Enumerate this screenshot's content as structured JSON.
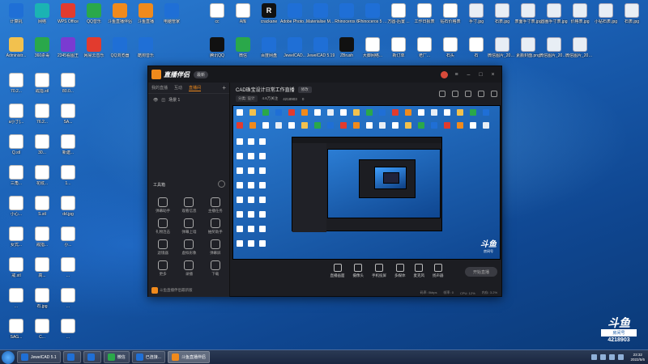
{
  "desktop": {
    "top_row": [
      {
        "label": "计算机",
        "color": "#1f6fd6"
      },
      {
        "label": "网络",
        "color": "#1bb3b3"
      },
      {
        "label": "WPS Office",
        "color": "#e23b2e"
      },
      {
        "label": "QQ音乐",
        "color": "#2aa84a"
      },
      {
        "label": "斗鱼直播伴侣",
        "color": "#f08a1c"
      },
      {
        "label": "斗鱼直播",
        "color": "#f08a1c"
      },
      {
        "label": "电脑管家",
        "color": "#1f6fd6"
      }
    ],
    "second_row": [
      {
        "label": "Administr...",
        "color": "#f2c14e"
      },
      {
        "label": "360杀毒",
        "color": "#2aa84a"
      },
      {
        "label": "2345看图王",
        "color": "#7a3bd1"
      },
      {
        "label": "网易云音乐",
        "color": "#e23b2e"
      },
      {
        "label": "QQ浏览器",
        "color": "#1f6fd6"
      },
      {
        "label": "酷狗音乐",
        "color": "#1f6fd6"
      }
    ],
    "top_files": [
      {
        "label": "cc",
        "type": "doc"
      },
      {
        "label": "A库",
        "type": "doc"
      },
      {
        "label": "crackane",
        "type": "black",
        "glyph": "R"
      },
      {
        "label": "Adobe Photosh...",
        "type": "blue"
      },
      {
        "label": "Materialise Magics 21.0",
        "type": "blue"
      },
      {
        "label": "Rhinoceros 6",
        "type": "blue"
      },
      {
        "label": "Rhinoceros 5 (64-bit)",
        "type": "blue"
      },
      {
        "label": "方圆-后置 ...",
        "type": "xls"
      },
      {
        "label": "工作日报表",
        "type": "xls"
      },
      {
        "label": "钻石价格表",
        "type": "xls"
      },
      {
        "label": "手寸.jpg",
        "type": "img"
      },
      {
        "label": "石表.jpg",
        "type": "img"
      },
      {
        "label": "表面手寸表.jpg",
        "type": "img"
      },
      {
        "label": "圆圈手寸表.jpg",
        "type": "img"
      },
      {
        "label": "价格表.jpg",
        "type": "img"
      },
      {
        "label": "小钻石表.jpg",
        "type": "img"
      },
      {
        "label": "石表.jpg",
        "type": "img"
      }
    ],
    "second_files": [
      {
        "label": "腾讯QQ",
        "type": "black"
      },
      {
        "label": "微信",
        "type": "green"
      },
      {
        "label": "百度网盘",
        "type": "blue"
      },
      {
        "label": "JewelCAD...",
        "type": "blue"
      },
      {
        "label": "JewelCAD 5.19",
        "type": "blue"
      },
      {
        "label": "ZBrush",
        "type": "black"
      },
      {
        "label": "大脚网络...",
        "type": "xls"
      },
      {
        "label": "新订单",
        "type": "xls"
      },
      {
        "label": "老厂...",
        "type": "xls"
      },
      {
        "label": "石头",
        "type": "xls"
      },
      {
        "label": "石",
        "type": "xls"
      },
      {
        "label": "微信图片_20210...",
        "type": "img"
      },
      {
        "label": "素颜封面.png",
        "type": "img"
      },
      {
        "label": "微信图片_2022031...",
        "type": "img"
      },
      {
        "label": "微信图片_2022031...",
        "type": "img"
      }
    ],
    "left_column": [
      {
        "label": "70.2...",
        "type": "doc"
      },
      {
        "label": "戒指.stl",
        "type": "cat"
      },
      {
        "label": "80.0...",
        "type": "cat"
      },
      {
        "label": "a小丁(...",
        "type": "cat"
      },
      {
        "label": "76.2...",
        "type": "doc"
      },
      {
        "label": "SA...",
        "type": "cat"
      },
      {
        "label": "Q.stl",
        "type": "doc"
      },
      {
        "label": "30...",
        "type": "doc"
      },
      {
        "label": "新建...",
        "type": "doc"
      },
      {
        "label": "三角...",
        "type": "doc"
      },
      {
        "label": "花纹...",
        "type": "doc"
      },
      {
        "label": "1...",
        "type": "doc"
      },
      {
        "label": "小心...",
        "type": "cat"
      },
      {
        "label": "S.stl",
        "type": "cat"
      },
      {
        "label": "dd.jpg",
        "type": "cat"
      },
      {
        "label": "女式...",
        "type": "doc"
      },
      {
        "label": "戒指...",
        "type": "cat"
      },
      {
        "label": "小...",
        "type": "cat"
      },
      {
        "label": "戒.stl",
        "type": "doc"
      },
      {
        "label": "高...",
        "type": "doc"
      },
      {
        "label": "...",
        "type": "doc"
      },
      {
        "label": "...",
        "type": "doc"
      },
      {
        "label": "石.jpg",
        "type": "doc"
      },
      {
        "label": "...",
        "type": "doc"
      },
      {
        "label": "SAG...",
        "type": "cat"
      },
      {
        "label": "C...",
        "type": "cat"
      },
      {
        "label": "...",
        "type": "doc"
      }
    ]
  },
  "app": {
    "logo_text": "直播伴侣",
    "version": "最新",
    "side_tabs": [
      "我的直播",
      "互动",
      "直播间"
    ],
    "scene_label": "场景 1",
    "tools_title": "工具箱",
    "tools": [
      {
        "label": "弹幕助手"
      },
      {
        "label": "观看信息"
      },
      {
        "label": "主播任务"
      },
      {
        "label": "礼物连击"
      },
      {
        "label": "弹幕上墙"
      },
      {
        "label": "抽奖助手"
      },
      {
        "label": "滤镜器"
      },
      {
        "label": "虚拟形象"
      },
      {
        "label": "弹幕屏"
      },
      {
        "label": "更多"
      },
      {
        "label": "录播"
      },
      {
        "label": "下载"
      }
    ],
    "promo_text": "斗鱼直播伴侣最新版",
    "room_title": "CAD珠宝设计日常工作直播",
    "edit_label": "修改",
    "meta": [
      "分类: 设计",
      "4.6万关注",
      "4218903",
      "0"
    ],
    "bottom_tools": [
      "直播画面",
      "摄像头",
      "手机投屏",
      "多媒体",
      "麦克风",
      "扬声器"
    ],
    "start_live": "开始直播",
    "status": [
      "码率: 0kbps",
      "帧率: 0",
      "CPU: 12%",
      "内存: 3.2%"
    ],
    "preview_watermark_big": "斗鱼",
    "preview_watermark_small": "房间号"
  },
  "watermark": {
    "logo": "斗鱼",
    "sub": "房间号",
    "room_number": "4218903"
  },
  "taskbar": {
    "tasks": [
      {
        "label": "JewelCAD 5.1",
        "color": "#1f6fd6",
        "active": false
      },
      {
        "label": "",
        "color": "#1f6fd6",
        "active": false
      },
      {
        "label": "",
        "color": "#1f6fd6",
        "active": false
      },
      {
        "label": "微信",
        "color": "#2aa84a",
        "active": false
      },
      {
        "label": "已连接...",
        "color": "#1f6fd6",
        "active": false
      },
      {
        "label": "斗鱼直播伴侣",
        "color": "#f08a1c",
        "active": true
      }
    ],
    "clock_time": "23:32",
    "clock_date": "2022/5/6"
  }
}
